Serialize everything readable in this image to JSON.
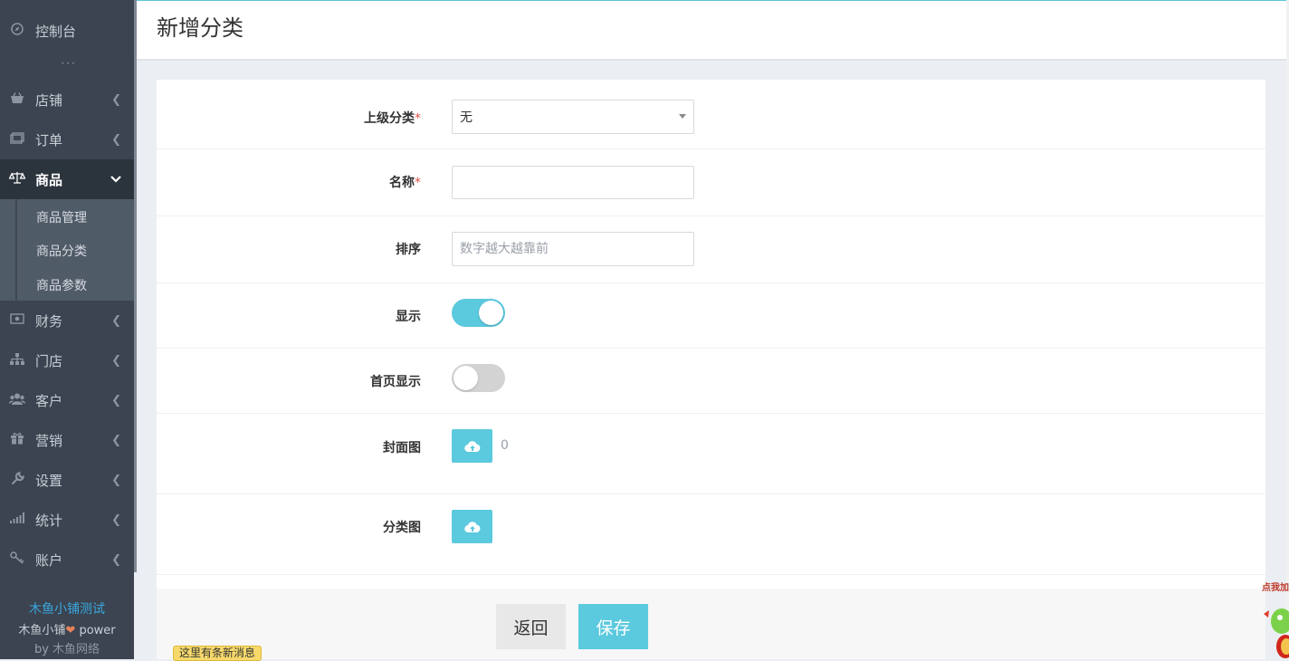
{
  "sidebar": {
    "dashboard": "控制台",
    "items": [
      {
        "label": "店铺",
        "icon": "shop-icon"
      },
      {
        "label": "订单",
        "icon": "order-icon"
      },
      {
        "label": "商品",
        "icon": "scale-icon"
      },
      {
        "label": "财务",
        "icon": "money-icon"
      },
      {
        "label": "门店",
        "icon": "sitemap-icon"
      },
      {
        "label": "客户",
        "icon": "users-icon"
      },
      {
        "label": "营销",
        "icon": "gift-icon"
      },
      {
        "label": "设置",
        "icon": "wrench-icon"
      },
      {
        "label": "统计",
        "icon": "bar-signal-icon"
      },
      {
        "label": "账户",
        "icon": "key-icon"
      }
    ],
    "submenu": [
      "商品管理",
      "商品分类",
      "商品参数"
    ],
    "footer": {
      "shop_name": "木鱼小铺测试",
      "power_prefix": "木鱼小铺",
      "power_suffix": "power",
      "by_prefix": "by",
      "by_name": "木鱼网络"
    }
  },
  "header": {
    "title": "新增分类"
  },
  "form": {
    "parent": {
      "label": "上级分类",
      "required": "*",
      "value": "无"
    },
    "name": {
      "label": "名称",
      "required": "*",
      "value": ""
    },
    "sort": {
      "label": "排序",
      "placeholder": "数字越大越靠前"
    },
    "show": {
      "label": "显示",
      "on": true
    },
    "home_show": {
      "label": "首页显示",
      "on": false
    },
    "cover": {
      "label": "封面图",
      "count": "0"
    },
    "category_image": {
      "label": "分类图"
    }
  },
  "buttons": {
    "back": "返回",
    "save": "保存"
  },
  "notice": "这里有条新消息",
  "mascot_text": "点我加",
  "colors": {
    "accent": "#5bc9de",
    "sidebar": "#3b4450",
    "required": "#e4554b",
    "footer_link": "#3aa8e0"
  }
}
